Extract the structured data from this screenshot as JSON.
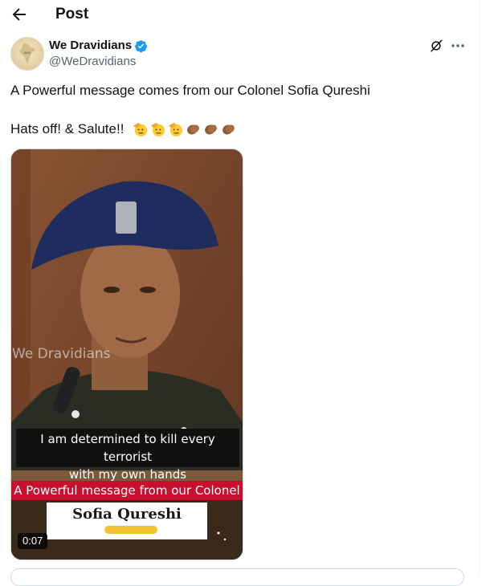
{
  "header": {
    "title": "Post"
  },
  "author": {
    "display_name": "We Dravidians",
    "handle": "@WeDravidians"
  },
  "tweet": {
    "line1": "A Powerful message comes from our Colonel Sofia Qureshi",
    "line2": "Hats off! & Salute!!",
    "emojis": [
      "saluting-face",
      "saluting-face",
      "saluting-face",
      "clapping-hands",
      "clapping-hands",
      "clapping-hands"
    ]
  },
  "video": {
    "watermark": "We Dravidians",
    "caption_line1": "I am determined to kill every terrorist",
    "caption_line2": "with my own hands",
    "banner": "A Powerful message from our Colonel",
    "name_card": "Sofia Qureshi",
    "duration": "0:07"
  },
  "colors": {
    "accent": "#1d9bf0",
    "secondary_text": "#536471",
    "banner_red": "#c8102e"
  }
}
